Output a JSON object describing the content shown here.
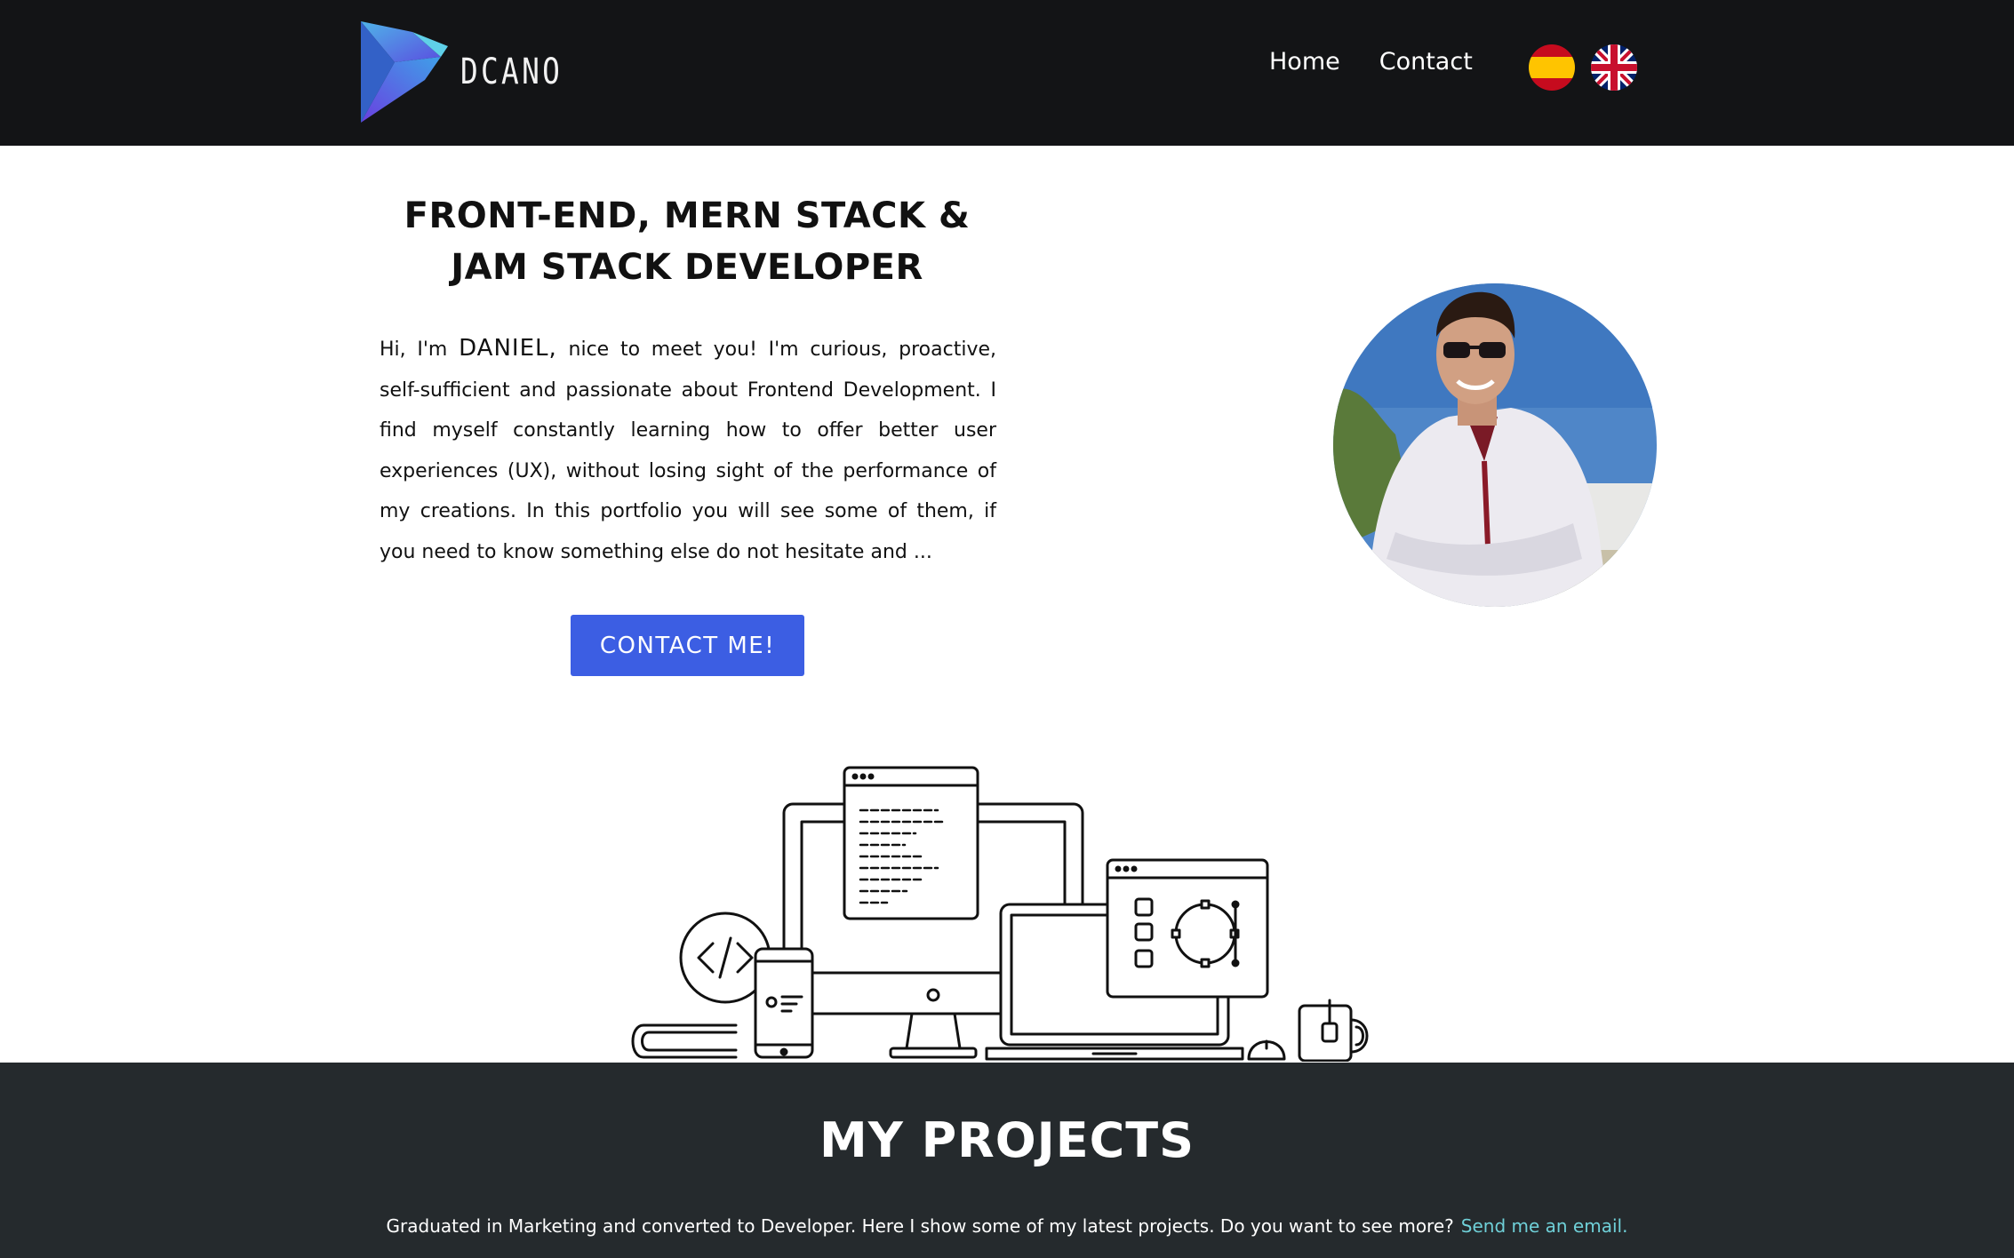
{
  "header": {
    "brand": "DCANO",
    "nav": [
      {
        "label": "Home"
      },
      {
        "label": "Contact"
      }
    ],
    "languages": [
      {
        "icon": "spain-flag-icon"
      },
      {
        "icon": "uk-flag-icon"
      }
    ]
  },
  "hero": {
    "title": "FRONT-END, MERN STACK & JAM STACK DEVELOPER",
    "intro_prefix": "Hi, I'm",
    "name": "DANIEL,",
    "intro_body": "nice to meet you! I'm curious, proactive, self-sufficient and passionate about Frontend Development. I find myself constantly learning how to offer better user experiences (UX), without losing sight of the performance of my creations. In this portfolio you will see some of them, if you need to know something else do not hesitate and ...",
    "cta_label": "CONTACT ME!"
  },
  "projects": {
    "title": "MY PROJECTS",
    "description": "Graduated in Marketing and converted to Developer. Here I show some of my latest projects. Do you want to see more?",
    "email_link": "Send me an email."
  },
  "colors": {
    "header_bg": "#131416",
    "accent": "#3c5ee3",
    "projects_bg": "#252a2d",
    "link": "#6fd0d8"
  }
}
